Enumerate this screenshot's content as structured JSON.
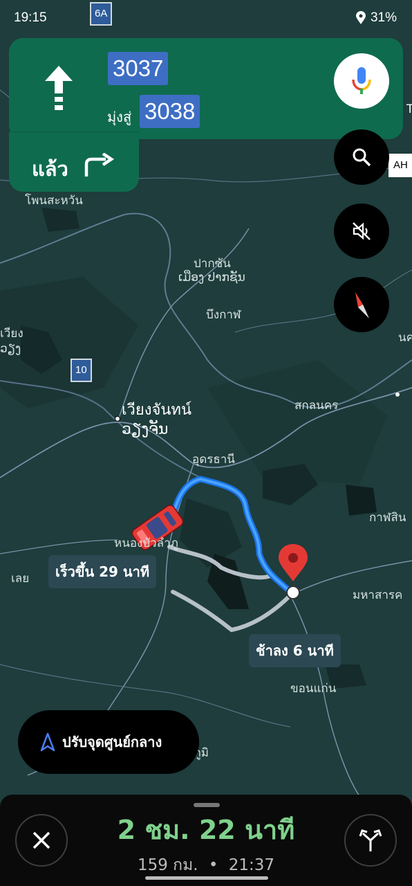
{
  "status_bar": {
    "time": "19:15",
    "battery": "31%"
  },
  "navigation": {
    "primary_road": "3037",
    "toward_label": "มุ่งสู่",
    "toward_road": "3038",
    "then_label": "แล้ว"
  },
  "map": {
    "highway_shields": [
      "6A",
      "10"
    ],
    "edge_label_ah": "AH",
    "edge_label_t": "T",
    "places": {
      "phon_sa_at_top": "โพนสะหวัน",
      "pak_san": "ปากซัน",
      "pak_san_lao": "ເມືອງ ປາກຊັນ",
      "bueng_kan": "บึงกาฬ",
      "vientiane": "เวียงจันทน์",
      "vientiane_lao": "ວຽງຈັນ",
      "viang_edge": "เวียง",
      "viang_edge_lao": "ວຽງ",
      "sakon_nakhon": "สกลนคร",
      "udon_thani": "อุดรธานี",
      "kalasin": "กาฬสิน",
      "nong_bua_lamphu": "หนองบัวลำภู",
      "loei": "เลย",
      "maha_sarakham": "มหาสารค",
      "khon_kaen": "ขอนแก่น",
      "chaiyaphum": "ชัยภูมิ",
      "nakhon_edge": "นค"
    }
  },
  "routes": {
    "faster": "เร็วขึ้น 29 นาที",
    "slower": "ช้าลง 6 นาที"
  },
  "recenter_label": "ปรับจุดศูนย์กลาง",
  "trip": {
    "duration": "2 ชม. 22 นาที",
    "distance": "159 กม.",
    "separator": "•",
    "arrival": "21:37"
  }
}
